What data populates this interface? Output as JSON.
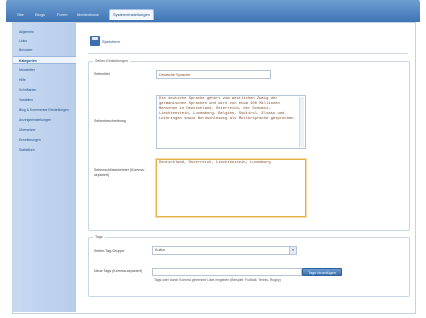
{
  "tabs": [
    {
      "label": "Site"
    },
    {
      "label": "Blogs"
    },
    {
      "label": "Foren"
    },
    {
      "label": "Medienbank"
    },
    {
      "label": "Systemeinstellungen"
    }
  ],
  "sidebar": {
    "items": [
      {
        "label": "Allgemein"
      },
      {
        "label": "Links"
      },
      {
        "label": "Benutzer"
      },
      {
        "label": "Kategorien"
      },
      {
        "label": "Newsletter"
      },
      {
        "label": "Hilfe"
      },
      {
        "label": "Schriftarten"
      },
      {
        "label": "Variablen"
      },
      {
        "label": "Blog & Kommentar Einstellungen"
      },
      {
        "label": "Anzeigeeinstellungen"
      },
      {
        "label": "Übersetzer"
      },
      {
        "label": "Erweiterungen"
      },
      {
        "label": "Statistiken"
      }
    ]
  },
  "toolbar": {
    "save_label": "Speichern"
  },
  "seo": {
    "legend": "Seiten-Einstellungen",
    "title_label": "Seitentitel",
    "title_value": "Deutsche Sprache",
    "desc_label": "Seitenbeschreibung",
    "desc_value": "Die deutsche Sprache gehört zum westlichen Zweig der germanischen Sprachen und wird von etwa 100 Millionen Menschen in Deutschland, Österreich, der Schweiz, Liechtenstein, Luxemburg, Belgien, Südtirol, Elsass und Lothringen sowie Nordschleswig als Muttersprache gesprochen.",
    "keywords_label": "Seitenschlüsselwörter (Komma-separiert)",
    "keywords_value": "Deutschland, Österreich, Liechtenstein, Luxemburg"
  },
  "tags": {
    "legend": "Tags",
    "group_label": "Seiten-Tag-Gruppe",
    "group_value": "Kultur",
    "add_label": "Neue Tags (Komma-separiert)",
    "add_value": "",
    "add_button": "Tags hinzufügen",
    "hint": "Tags oder durch Komma getrennte Liste eingeben (Beispiel: Fußball, Tennis, Rugby)"
  }
}
